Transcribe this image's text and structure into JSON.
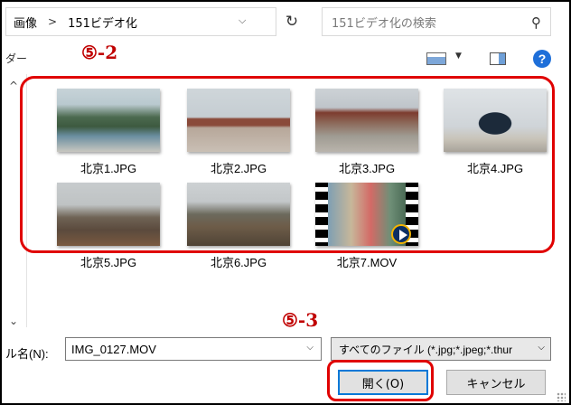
{
  "address": {
    "crumbs": [
      "画像",
      "151ビデオ化"
    ],
    "separator": ">",
    "dropdown_icon": "chevron-down-icon",
    "refresh_icon": "refresh-icon"
  },
  "search": {
    "placeholder": "151ビデオ化の検索",
    "icon": "search-icon"
  },
  "toolbar": {
    "fragment": "ダー",
    "view_icon": "view-icon",
    "pane_icon": "preview-pane-icon",
    "help_icon": "?"
  },
  "annotations": {
    "top": "⑤-2",
    "bottom": "⑤-3",
    "color": "#e00000"
  },
  "files": [
    {
      "name": "北京1.JPG"
    },
    {
      "name": "北京2.JPG"
    },
    {
      "name": "北京3.JPG"
    },
    {
      "name": "北京4.JPG"
    },
    {
      "name": "北京5.JPG"
    },
    {
      "name": "北京6.JPG"
    },
    {
      "name": "北京7.MOV"
    }
  ],
  "filename": {
    "label": "ル名(N):",
    "value": "IMG_0127.MOV"
  },
  "filetype": {
    "value": "すべてのファイル (*.jpg;*.jpeg;*.thur"
  },
  "buttons": {
    "open": "開く(O)",
    "cancel": "キャンセル"
  },
  "colors": {
    "accent": "#0078d7",
    "help": "#1e6fd9"
  }
}
